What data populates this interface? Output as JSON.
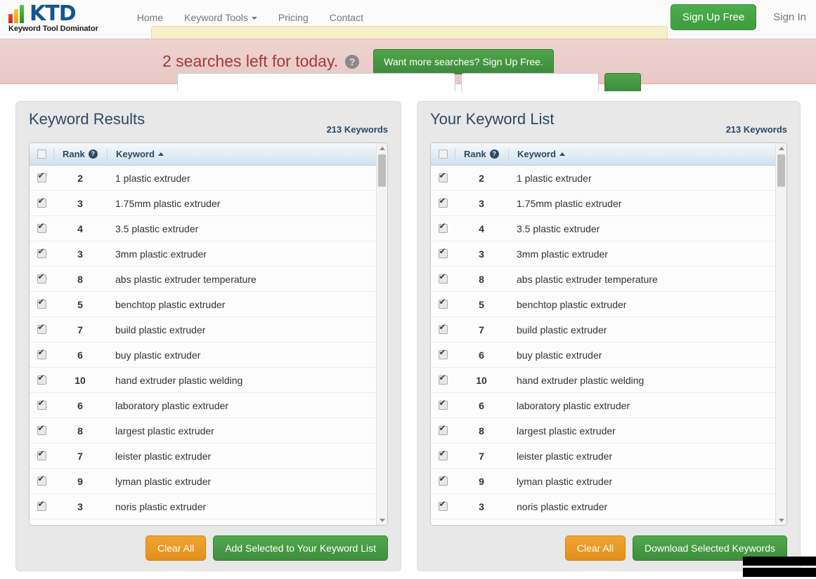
{
  "navbar": {
    "brand": {
      "abbr": "KTD",
      "tagline": "Keyword Tool Dominator"
    },
    "links": [
      {
        "label": "Home",
        "caret": false
      },
      {
        "label": "Keyword Tools",
        "caret": true
      },
      {
        "label": "Pricing",
        "caret": false
      },
      {
        "label": "Contact",
        "caret": false
      }
    ],
    "signup_label": "Sign Up Free",
    "signin_label": "Sign In"
  },
  "alert": {
    "message": "2 searches left for today.",
    "help_glyph": "?",
    "cta_label": "Want more searches? Sign Up Free."
  },
  "search": {
    "keyword_value": "",
    "keyword_placeholder": "",
    "engine_value": "",
    "engine_placeholder": "",
    "go_label": ""
  },
  "panels": [
    {
      "id": "keyword-results",
      "title": "Keyword Results",
      "count": "213 Keywords",
      "columns": {
        "rank": "Rank",
        "keyword": "Keyword",
        "help_glyph": "?"
      },
      "rows": [
        {
          "rank": "2",
          "keyword": "1 plastic extruder",
          "checked": true
        },
        {
          "rank": "3",
          "keyword": "1.75mm plastic extruder",
          "checked": true
        },
        {
          "rank": "4",
          "keyword": "3.5 plastic extruder",
          "checked": true
        },
        {
          "rank": "3",
          "keyword": "3mm plastic extruder",
          "checked": true
        },
        {
          "rank": "8",
          "keyword": "abs plastic extruder temperature",
          "checked": true
        },
        {
          "rank": "5",
          "keyword": "benchtop plastic extruder",
          "checked": true
        },
        {
          "rank": "7",
          "keyword": "build plastic extruder",
          "checked": true
        },
        {
          "rank": "6",
          "keyword": "buy plastic extruder",
          "checked": true
        },
        {
          "rank": "10",
          "keyword": "hand extruder plastic welding",
          "checked": true
        },
        {
          "rank": "6",
          "keyword": "laboratory plastic extruder",
          "checked": true
        },
        {
          "rank": "8",
          "keyword": "largest plastic extruder",
          "checked": true
        },
        {
          "rank": "7",
          "keyword": "leister plastic extruder",
          "checked": true
        },
        {
          "rank": "9",
          "keyword": "lyman plastic extruder",
          "checked": true
        },
        {
          "rank": "3",
          "keyword": "noris plastic extruder",
          "checked": true
        }
      ],
      "actions": {
        "clear_label": "Clear All",
        "primary_label": "Add Selected to Your Keyword List"
      }
    },
    {
      "id": "your-keyword-list",
      "title": "Your Keyword List",
      "count": "213 Keywords",
      "columns": {
        "rank": "Rank",
        "keyword": "Keyword",
        "help_glyph": "?"
      },
      "rows": [
        {
          "rank": "2",
          "keyword": "1 plastic extruder",
          "checked": true
        },
        {
          "rank": "3",
          "keyword": "1.75mm plastic extruder",
          "checked": true
        },
        {
          "rank": "4",
          "keyword": "3.5 plastic extruder",
          "checked": true
        },
        {
          "rank": "3",
          "keyword": "3mm plastic extruder",
          "checked": true
        },
        {
          "rank": "8",
          "keyword": "abs plastic extruder temperature",
          "checked": true
        },
        {
          "rank": "5",
          "keyword": "benchtop plastic extruder",
          "checked": true
        },
        {
          "rank": "7",
          "keyword": "build plastic extruder",
          "checked": true
        },
        {
          "rank": "6",
          "keyword": "buy plastic extruder",
          "checked": true
        },
        {
          "rank": "10",
          "keyword": "hand extruder plastic welding",
          "checked": true
        },
        {
          "rank": "6",
          "keyword": "laboratory plastic extruder",
          "checked": true
        },
        {
          "rank": "8",
          "keyword": "largest plastic extruder",
          "checked": true
        },
        {
          "rank": "7",
          "keyword": "leister plastic extruder",
          "checked": true
        },
        {
          "rank": "9",
          "keyword": "lyman plastic extruder",
          "checked": true
        },
        {
          "rank": "3",
          "keyword": "noris plastic extruder",
          "checked": true
        }
      ],
      "actions": {
        "clear_label": "Clear All",
        "primary_label": "Download Selected Keywords"
      }
    }
  ],
  "colors": {
    "brand_blue": "#14558f",
    "green": "#3f8e3c",
    "orange": "#e2901c",
    "alert_pink": "#e7c8c5",
    "alert_text": "#a53a36",
    "header_blue": "#2b4a66"
  }
}
